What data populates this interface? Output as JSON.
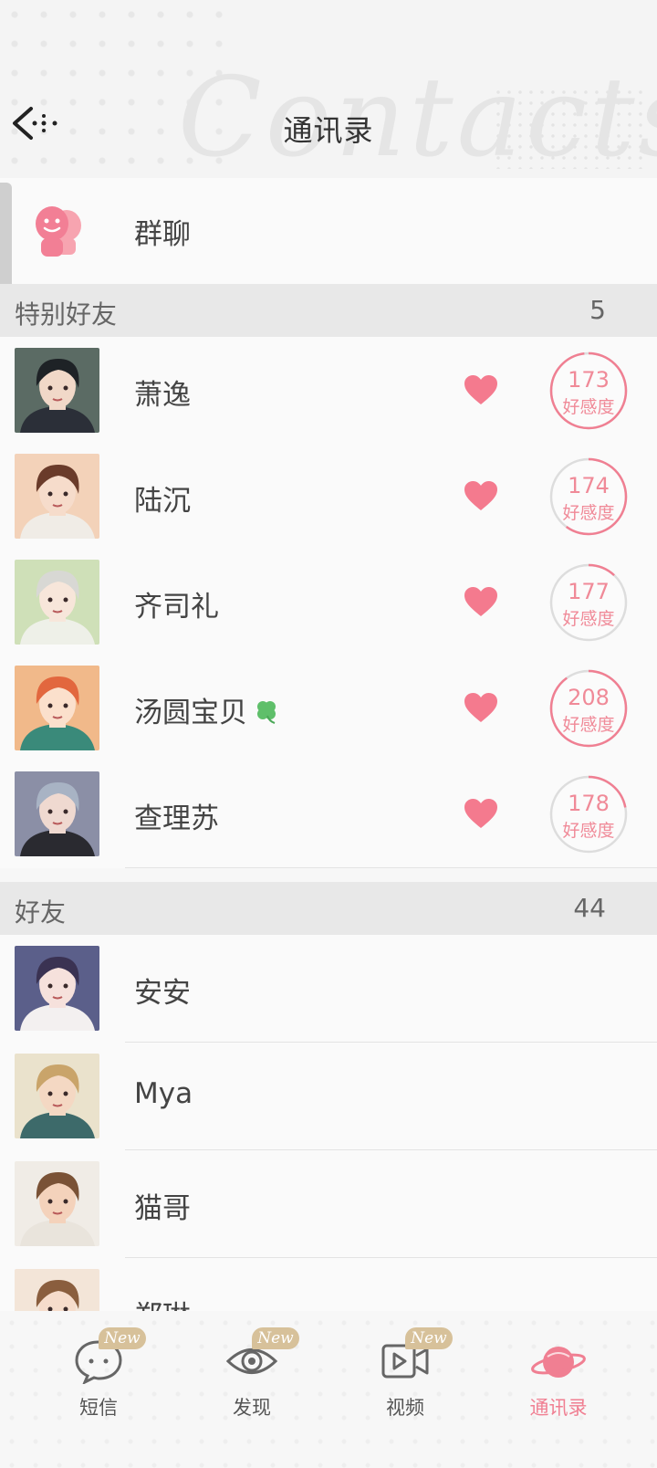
{
  "header": {
    "title": "通讯录",
    "watermark": "Contacts"
  },
  "group_chat": {
    "label": "群聊"
  },
  "sections": {
    "special": {
      "title": "特别好友",
      "count": "5"
    },
    "friends": {
      "title": "好友",
      "count": "44"
    }
  },
  "special_friends": [
    {
      "name": "萧逸",
      "affection": "173",
      "affection_label": "好感度",
      "affection_level": 0.98,
      "heart": true
    },
    {
      "name": "陆沉",
      "affection": "174",
      "affection_label": "好感度",
      "affection_level": 0.6,
      "heart": true
    },
    {
      "name": "齐司礼",
      "affection": "177",
      "affection_label": "好感度",
      "affection_level": 0.12,
      "heart": true
    },
    {
      "name": "汤圆宝贝",
      "affection": "208",
      "affection_label": "好感度",
      "affection_level": 0.9,
      "heart": true,
      "badge_icon": "clover-icon"
    },
    {
      "name": "查理苏",
      "affection": "178",
      "affection_label": "好感度",
      "affection_level": 0.22,
      "heart": true
    }
  ],
  "friends": [
    {
      "name": "安安"
    },
    {
      "name": "Mya"
    },
    {
      "name": "猫哥"
    },
    {
      "name": "郑琳"
    }
  ],
  "tabbar": {
    "tabs": [
      {
        "label": "短信",
        "icon": "chat-bubble-icon",
        "badge": "New"
      },
      {
        "label": "发现",
        "icon": "eye-icon",
        "badge": "New"
      },
      {
        "label": "视频",
        "icon": "video-icon",
        "badge": "New"
      },
      {
        "label": "通讯录",
        "icon": "planet-contacts-icon",
        "active": true
      }
    ]
  },
  "colors": {
    "accent_pink": "#f07f92",
    "heart": "#f47a8e",
    "badge_gold": "#d7c19a"
  }
}
